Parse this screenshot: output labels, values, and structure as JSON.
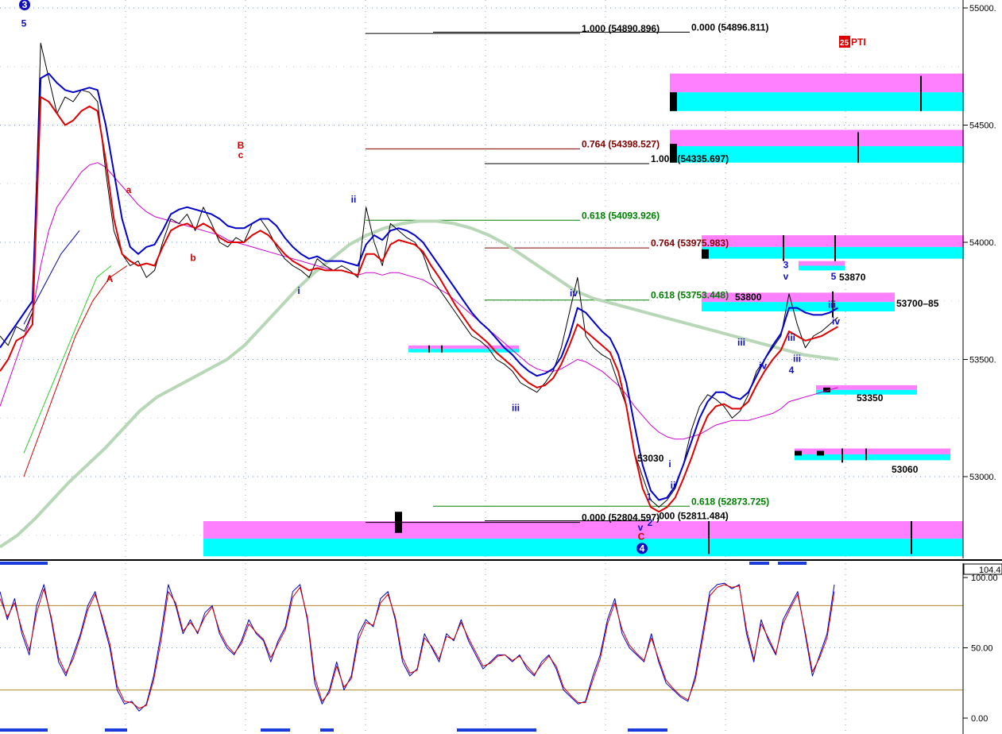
{
  "chart_data": [
    {
      "type": "line",
      "panel": "price",
      "ylim": [
        52650,
        55030
      ],
      "y_ticks": [
        "55000.",
        "54500.",
        "54000.",
        "53500.",
        "53000."
      ],
      "y_tick_values": [
        55000,
        54500,
        54000,
        53500,
        53000
      ],
      "grid": true,
      "logo_text": "PTI",
      "logo_number": "25",
      "series": [
        {
          "key": "price",
          "color": "#000000",
          "values": [
            53600,
            53560,
            53640,
            53620,
            53700,
            54850,
            54700,
            54550,
            54620,
            54600,
            54650,
            54640,
            54600,
            54300,
            54050,
            53950,
            53900,
            53920,
            53850,
            53880,
            54000,
            54100,
            54080,
            54120,
            54050,
            54150,
            54080,
            54000,
            53980,
            54020,
            54000,
            54080,
            54100,
            54050,
            53980,
            53930,
            53900,
            53880,
            53850,
            53930,
            53900,
            53880,
            53900,
            53880,
            53850,
            54150,
            54000,
            53900,
            54080,
            54050,
            54020,
            54000,
            53950,
            53850,
            53800,
            53750,
            53700,
            53650,
            53600,
            53580,
            53550,
            53500,
            53480,
            53450,
            53400,
            53380,
            53360,
            53400,
            53450,
            53550,
            53700,
            53850,
            53600,
            53550,
            53520,
            53500,
            53400,
            53300,
            53100,
            53000,
            52900,
            52870,
            52900,
            52950,
            53050,
            53200,
            53300,
            53350,
            53330,
            53300,
            53250,
            53280,
            53350,
            53450,
            53500,
            53550,
            53600,
            53780,
            53650,
            53550,
            53600,
            53620,
            53650,
            53680
          ]
        },
        {
          "key": "fast-red",
          "color": "#e00000",
          "values": [
            53450,
            53500,
            53580,
            53600,
            53650,
            54620,
            54600,
            54550,
            54500,
            54520,
            54560,
            54580,
            54560,
            54350,
            54100,
            53950,
            53920,
            53900,
            53910,
            53900,
            53980,
            54050,
            54070,
            54080,
            54060,
            54080,
            54060,
            54020,
            54000,
            54000,
            54000,
            54030,
            54050,
            54030,
            53990,
            53950,
            53920,
            53900,
            53880,
            53890,
            53880,
            53880,
            53880,
            53870,
            53860,
            53950,
            53950,
            53920,
            53990,
            54010,
            54000,
            53990,
            53960,
            53900,
            53850,
            53790,
            53730,
            53680,
            53630,
            53600,
            53570,
            53530,
            53500,
            53470,
            53430,
            53400,
            53380,
            53390,
            53420,
            53480,
            53560,
            53650,
            53620,
            53590,
            53560,
            53530,
            53450,
            53300,
            53100,
            52950,
            52870,
            52850,
            52870,
            52910,
            52990,
            53080,
            53180,
            53260,
            53300,
            53310,
            53290,
            53290,
            53320,
            53390,
            53450,
            53500,
            53540,
            53620,
            53600,
            53580,
            53590,
            53600,
            53620,
            53640
          ]
        },
        {
          "key": "fast-blue",
          "color": "#0000cc",
          "values": [
            53550,
            53600,
            53650,
            53700,
            53750,
            54700,
            54720,
            54680,
            54650,
            54640,
            54650,
            54660,
            54650,
            54500,
            54300,
            54100,
            53980,
            53950,
            53980,
            53990,
            54050,
            54120,
            54140,
            54150,
            54140,
            54130,
            54120,
            54100,
            54070,
            54060,
            54060,
            54080,
            54100,
            54100,
            54070,
            54020,
            53980,
            53950,
            53930,
            53940,
            53920,
            53920,
            53920,
            53910,
            53900,
            53990,
            54030,
            54010,
            54050,
            54060,
            54050,
            54030,
            54000,
            53950,
            53900,
            53850,
            53800,
            53750,
            53700,
            53660,
            53630,
            53590,
            53550,
            53520,
            53480,
            53450,
            53430,
            53440,
            53460,
            53510,
            53600,
            53720,
            53700,
            53660,
            53620,
            53590,
            53520,
            53400,
            53220,
            53050,
            52940,
            52900,
            52910,
            52960,
            53050,
            53150,
            53250,
            53320,
            53360,
            53360,
            53340,
            53330,
            53360,
            53430,
            53500,
            53560,
            53610,
            53720,
            53720,
            53700,
            53690,
            53690,
            53700,
            53720
          ]
        },
        {
          "key": "slow-magenta",
          "color": "#cc00cc",
          "values": [
            53300,
            53400,
            53500,
            53600,
            53700,
            53900,
            54050,
            54150,
            54200,
            54250,
            54300,
            54330,
            54340,
            54320,
            54280,
            54240,
            54200,
            54160,
            54130,
            54110,
            54100,
            54090,
            54080,
            54070,
            54060,
            54050,
            54040,
            54030,
            54010,
            54000,
            53990,
            53980,
            53970,
            53960,
            53950,
            53940,
            53930,
            53920,
            53910,
            53900,
            53890,
            53880,
            53880,
            53870,
            53860,
            53870,
            53870,
            53860,
            53870,
            53870,
            53860,
            53850,
            53840,
            53820,
            53800,
            53780,
            53750,
            53720,
            53690,
            53660,
            53630,
            53600,
            53570,
            53540,
            53510,
            53480,
            53460,
            53450,
            53450,
            53460,
            53480,
            53500,
            53490,
            53470,
            53450,
            53420,
            53390,
            53350,
            53300,
            53260,
            53220,
            53190,
            53170,
            53160,
            53160,
            53170,
            53180,
            53200,
            53220,
            53230,
            53240,
            53240,
            53240,
            53250,
            53260,
            53270,
            53290,
            53320,
            53330,
            53340,
            53350,
            53360,
            53370,
            53380
          ]
        },
        {
          "key": "ma-green",
          "color": "#33cc33",
          "values": [
            53100,
            53250,
            53400,
            53550,
            53700,
            53850,
            53900
          ]
        },
        {
          "key": "ma-darkred",
          "color": "#cc0000",
          "values": [
            53000,
            53200,
            53400,
            53600,
            53750,
            53850,
            53900
          ]
        },
        {
          "key": "ma-blue-long",
          "color": "#0000aa",
          "values": [
            53650,
            53800,
            53950,
            54050
          ]
        },
        {
          "key": "ma-gray-green",
          "color": "#b7d7b7",
          "values": [
            52700,
            52750,
            52820,
            52900,
            52980,
            53050,
            53120,
            53200,
            53280,
            53340,
            53380,
            53420,
            53460,
            53500,
            53560,
            53640,
            53720,
            53800,
            53870,
            53930,
            53990,
            54030,
            54060,
            54080,
            54090,
            54090,
            54080,
            54060,
            54030,
            53990,
            53940,
            53890,
            53840,
            53790,
            53760,
            53740,
            53720,
            53700,
            53680,
            53660,
            53640,
            53620,
            53600,
            53580,
            53560,
            53540,
            53520,
            53510,
            53500
          ]
        }
      ],
      "fib_labels": [
        {
          "text": "1.000 (54890.896)",
          "value": 54890.896,
          "color": "#000000"
        },
        {
          "text": "0.000 (54896.811)",
          "value": 54896.811,
          "color": "#000000"
        },
        {
          "text": "0.764 (54398.527)",
          "value": 54398.527,
          "color": "#800000"
        },
        {
          "text": "1.000 (54335.697)",
          "value": 54335.697,
          "color": "#000000"
        },
        {
          "text": "0.618 (54093.926)",
          "value": 54093.926,
          "color": "#008000"
        },
        {
          "text": "0.764 (53975.983)",
          "value": 53975.983,
          "color": "#800000"
        },
        {
          "text": "0.618 (53753.448)",
          "value": 53753.448,
          "color": "#008000"
        },
        {
          "text": "0.618 (52873.725)",
          "value": 52873.725,
          "color": "#008000"
        },
        {
          "text": "0.000 (52804.597)",
          "value": 52804.597,
          "color": "#000000"
        },
        {
          "text": ".000 (52811.484)",
          "value": 52811.484,
          "color": "#000000"
        }
      ],
      "price_labels": [
        {
          "text": "53870",
          "value": 53870
        },
        {
          "text": "53800",
          "value": 53800
        },
        {
          "text": "53700–85",
          "value": 53700
        },
        {
          "text": "53350",
          "value": 53350
        },
        {
          "text": "53030",
          "value": 53030
        },
        {
          "text": "53060",
          "value": 53060
        }
      ],
      "wave_labels": [
        {
          "text": "3",
          "value": 55000,
          "color": "#1010c0",
          "circled": true
        },
        {
          "text": "5",
          "value": 54920,
          "color": "#1010c0"
        },
        {
          "text": "A",
          "value": 53830,
          "color": "#cc0000"
        },
        {
          "text": "a",
          "value": 54210,
          "color": "#cc0000"
        },
        {
          "text": "b",
          "value": 53920,
          "color": "#cc0000"
        },
        {
          "text": "B",
          "value": 54400,
          "color": "#cc0000"
        },
        {
          "text": "c",
          "value": 54360,
          "color": "#cc0000"
        },
        {
          "text": "i",
          "value": 53780,
          "color": "#1010c0"
        },
        {
          "text": "ii",
          "value": 54170,
          "color": "#1010c0"
        },
        {
          "text": "iii",
          "value": 53280,
          "color": "#1010c0"
        },
        {
          "text": "iv",
          "value": 53770,
          "color": "#1010c0"
        },
        {
          "text": "v",
          "value": 52770,
          "color": "#1010c0"
        },
        {
          "text": "C",
          "value": 52730,
          "color": "#cc0000"
        },
        {
          "text": "4",
          "value": 52680,
          "color": "#1010c0",
          "circled": true
        },
        {
          "text": "1",
          "value": 52900,
          "color": "#1010c0"
        },
        {
          "text": "2",
          "value": 52790,
          "color": "#1010c0"
        },
        {
          "text": "i",
          "value": 53040,
          "color": "#1010c0"
        },
        {
          "text": "ii",
          "value": 52950,
          "color": "#1010c0"
        },
        {
          "text": "iii",
          "value": 53560,
          "color": "#1010c0"
        },
        {
          "text": "iv",
          "value": 53460,
          "color": "#1010c0"
        },
        {
          "text": "3",
          "value": 53890,
          "color": "#1010c0"
        },
        {
          "text": "v",
          "value": 53840,
          "color": "#1010c0"
        },
        {
          "text": "iii",
          "value": 53580,
          "color": "#1010c0"
        },
        {
          "text": "4",
          "value": 53440,
          "color": "#1010c0"
        },
        {
          "text": "iii",
          "value": 53490,
          "color": "#1010c0"
        },
        {
          "text": "5",
          "value": 53840,
          "color": "#1010c0"
        },
        {
          "text": "iii",
          "value": 53720,
          "color": "#1010c0"
        },
        {
          "text": "iv",
          "value": 53650,
          "color": "#1010c0"
        }
      ]
    },
    {
      "type": "line",
      "panel": "oscillator",
      "ylim": [
        -10,
        110
      ],
      "y_ticks": [
        "104.4",
        "100.00",
        "50.00",
        "0.00"
      ],
      "y_tick_values": [
        104.4,
        100,
        50,
        0
      ],
      "hlines": [
        80,
        20
      ],
      "series": [
        {
          "key": "osc-blue",
          "color": "#0000cc",
          "values": [
            90,
            70,
            85,
            60,
            45,
            80,
            95,
            70,
            40,
            30,
            45,
            60,
            80,
            90,
            70,
            50,
            20,
            10,
            12,
            5,
            10,
            30,
            60,
            95,
            80,
            60,
            70,
            60,
            75,
            80,
            60,
            50,
            45,
            55,
            70,
            60,
            55,
            40,
            55,
            65,
            90,
            95,
            70,
            25,
            10,
            20,
            40,
            20,
            30,
            60,
            70,
            65,
            85,
            90,
            70,
            40,
            30,
            35,
            60,
            50,
            40,
            60,
            55,
            70,
            55,
            45,
            35,
            40,
            45,
            45,
            40,
            45,
            35,
            30,
            40,
            45,
            35,
            20,
            15,
            10,
            12,
            30,
            45,
            70,
            85,
            60,
            50,
            45,
            40,
            60,
            40,
            25,
            20,
            15,
            12,
            30,
            60,
            90,
            95,
            96,
            92,
            95,
            60,
            40,
            70,
            55,
            45,
            70,
            80,
            90,
            60,
            30,
            45,
            60,
            95
          ]
        },
        {
          "key": "osc-red",
          "color": "#cc0000",
          "values": [
            85,
            72,
            82,
            63,
            48,
            75,
            92,
            72,
            43,
            32,
            42,
            58,
            77,
            88,
            72,
            53,
            23,
            12,
            11,
            7,
            9,
            27,
            55,
            90,
            82,
            62,
            68,
            61,
            72,
            79,
            62,
            52,
            46,
            53,
            67,
            61,
            56,
            43,
            53,
            63,
            86,
            93,
            72,
            29,
            12,
            18,
            37,
            22,
            28,
            56,
            68,
            66,
            82,
            88,
            72,
            43,
            32,
            34,
            57,
            51,
            42,
            58,
            56,
            68,
            57,
            47,
            37,
            39,
            44,
            45,
            41,
            44,
            37,
            31,
            38,
            44,
            37,
            22,
            16,
            11,
            11,
            27,
            42,
            67,
            82,
            63,
            52,
            46,
            41,
            57,
            42,
            27,
            21,
            16,
            13,
            27,
            56,
            87,
            93,
            95,
            93,
            94,
            63,
            42,
            67,
            57,
            46,
            67,
            78,
            88,
            62,
            33,
            43,
            57,
            90
          ]
        }
      ]
    }
  ]
}
